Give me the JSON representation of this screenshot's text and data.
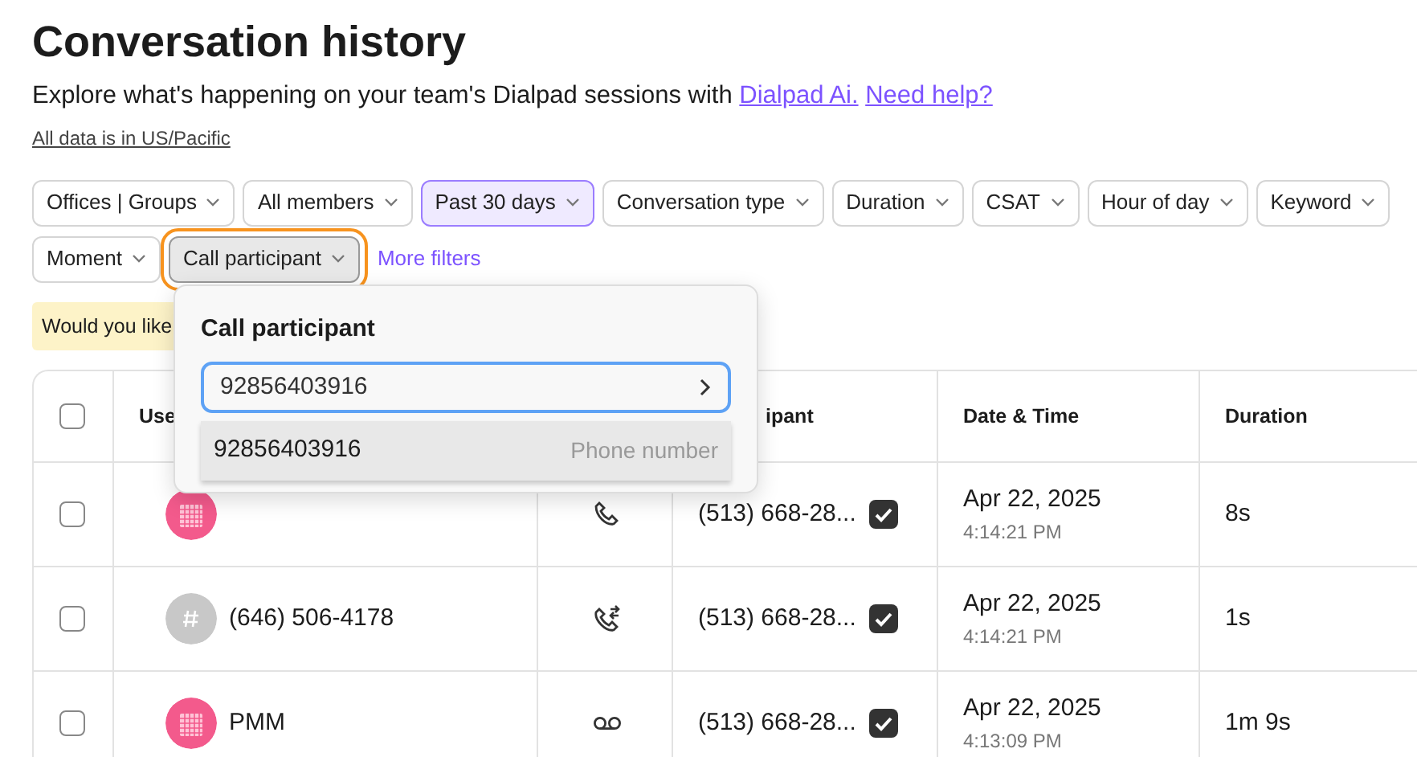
{
  "title": "Conversation history",
  "subtitle": {
    "text": "Explore what's happening on your team's Dialpad sessions with",
    "links": [
      "Dialpad Ai.",
      "Need help?"
    ]
  },
  "timezone_note": "All data is in US/Pacific",
  "filters": [
    {
      "label": "Offices | Groups",
      "active": false,
      "open": false
    },
    {
      "label": "All members",
      "active": false,
      "open": false
    },
    {
      "label": "Past 30 days",
      "active": true,
      "open": false
    },
    {
      "label": "Conversation type",
      "active": false,
      "open": false
    },
    {
      "label": "Duration",
      "active": false,
      "open": false
    },
    {
      "label": "CSAT",
      "active": false,
      "open": false
    },
    {
      "label": "Hour of day",
      "active": false,
      "open": false
    },
    {
      "label": "Keyword",
      "active": false,
      "open": false
    },
    {
      "label": "Moment",
      "active": false,
      "open": false
    },
    {
      "label": "Call participant",
      "active": false,
      "open": true
    }
  ],
  "more_filters": "More filters",
  "banner": "Would you like",
  "table": {
    "select_all_checked": false,
    "columns": [
      "Use",
      "",
      "ipant",
      "Date & Time",
      "Duration"
    ],
    "rows": [
      {
        "checked": false,
        "avatar": {
          "kind": "calendar"
        },
        "user": null,
        "call_icon": {
          "kind": "call"
        },
        "participant": "(513) 668-28...",
        "verified": true,
        "date": "Apr 22, 2025",
        "time": "4:14:21 PM",
        "duration": "8s"
      },
      {
        "checked": false,
        "avatar": {
          "kind": "number"
        },
        "user": "(646) 506-4178",
        "call_icon": {
          "kind": "transfer"
        },
        "participant": "(513) 668-28...",
        "verified": true,
        "date": "Apr 22, 2025",
        "time": "4:14:21 PM",
        "duration": "1s"
      },
      {
        "checked": false,
        "avatar": {
          "kind": "calendar"
        },
        "user": "PMM",
        "call_icon": {
          "kind": "voicemail"
        },
        "participant": "(513) 668-28...",
        "verified": true,
        "date": "Apr 22, 2025",
        "time": "4:13:09 PM",
        "duration": "1m 9s"
      }
    ]
  },
  "popover": {
    "title": "Call participant",
    "value": "92856403916",
    "suggestion": {
      "text": "92856403916",
      "type": "Phone number"
    }
  }
}
